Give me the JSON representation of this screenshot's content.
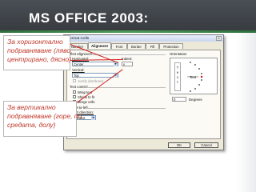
{
  "slide": {
    "title": "MS OFFICE 2003",
    "title_suffix": ":",
    "callouts": [
      {
        "lines": [
          "За хоризонтално",
          "подравняване (ляво,",
          "центрирано, дясно)"
        ]
      },
      {
        "lines": [
          "За вертикално",
          "подравняване (горе, по",
          "средата, долу)"
        ]
      }
    ]
  },
  "dialog": {
    "title": "Format Cells",
    "close_icon": "close-icon",
    "tabs": [
      "Number",
      "Alignment",
      "Font",
      "Border",
      "Fill",
      "Protection"
    ],
    "active_tab": "Alignment",
    "text_alignment": {
      "label": "Text alignment",
      "horizontal_label": "Horizontal:",
      "horizontal_value": "Center",
      "indent_label": "Indent:",
      "indent_value": "0",
      "vertical_label": "Vertical:",
      "vertical_value": "Top",
      "justify_distributed": "Justify distributed"
    },
    "text_control": {
      "label": "Text control",
      "wrap_text": "Wrap text",
      "shrink_to_fit": "Shrink to fit",
      "merge_cells": "Merge cells"
    },
    "right_to_left": {
      "label": "Right-to-left",
      "direction_label": "Text direction:",
      "direction_value": "Context"
    },
    "orientation": {
      "label": "Orientation",
      "vertical_text": "T e x t",
      "text_label": "Text",
      "degrees_value": "0",
      "degrees_label": "Degrees"
    },
    "buttons": {
      "ok": "OK",
      "cancel": "Cancel"
    }
  },
  "colors": {
    "title_bar": "#3e4247",
    "accent_band": "#4f9a5a",
    "callout_text": "#c0392b",
    "arrow": "#d21f1f"
  }
}
